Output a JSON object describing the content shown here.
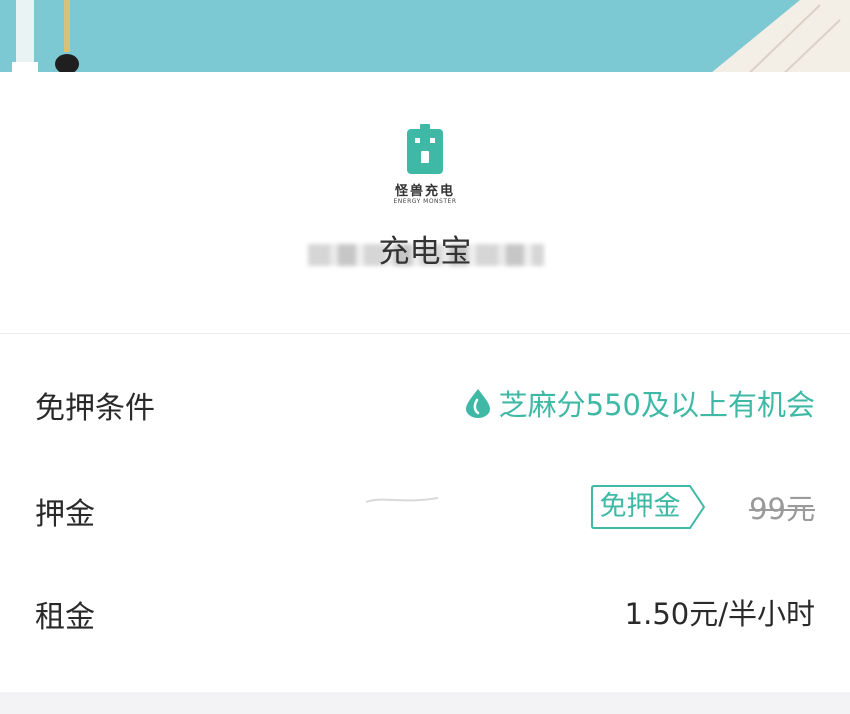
{
  "banner": {
    "color": "#7cc9d4"
  },
  "logo": {
    "cn": "怪兽充电",
    "en": "ENERGY MONSTER",
    "icon": "battery-icon"
  },
  "product": {
    "title": "充电宝"
  },
  "colors": {
    "accent": "#3fb9a6",
    "text": "#2a2a2a",
    "muted": "#9a9a9a"
  },
  "rows": {
    "deposit_condition": {
      "label": "免押条件",
      "value": "芝麻分550及以上有机会",
      "icon": "drop-icon"
    },
    "deposit": {
      "label": "押金",
      "badge": "免押金",
      "original": "99元"
    },
    "rent": {
      "label": "租金",
      "value": "1.50元/半小时"
    }
  }
}
